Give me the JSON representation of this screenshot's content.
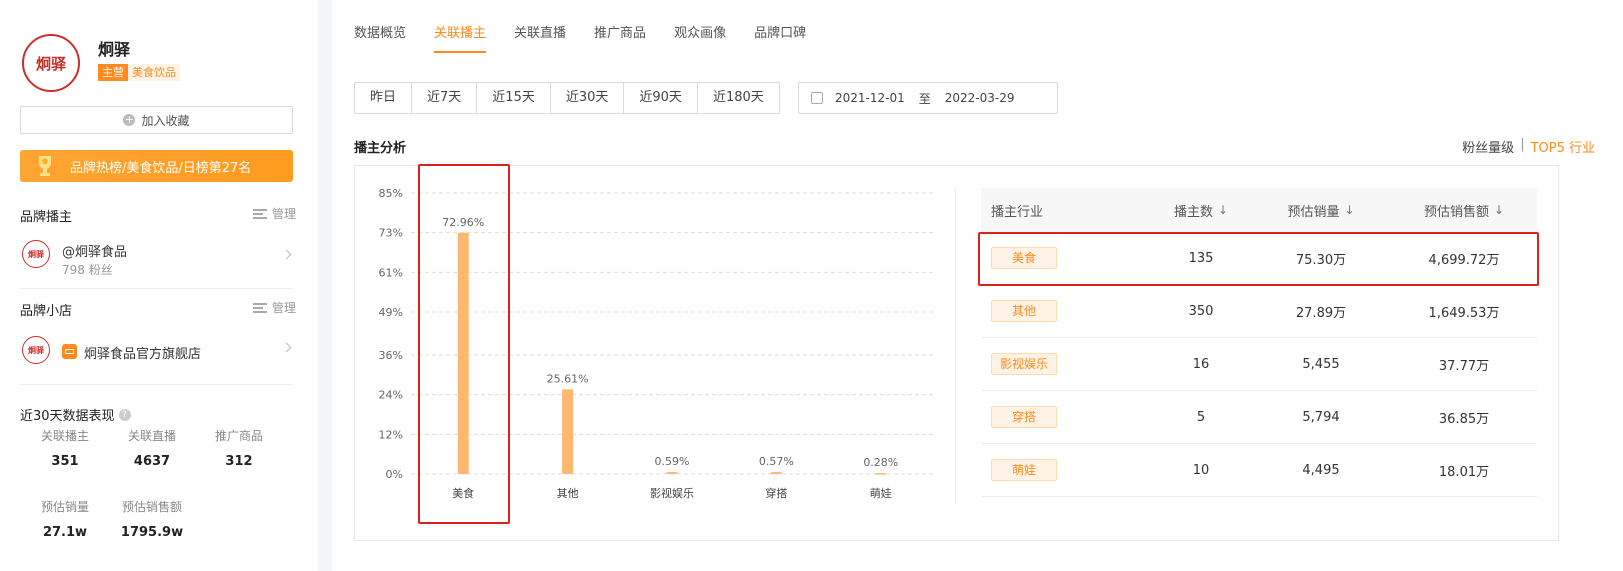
{
  "sidebar": {
    "brand_name": "炯驿",
    "logo_text": "炯驿",
    "tag_main": "主营",
    "tag_category": "美食饮品",
    "fav_button": "加入收藏",
    "rank_banner": "品牌热榜/美食饮品/日榜第27名",
    "anchor_section": "品牌播主",
    "manage_label": "管理",
    "anchor": {
      "name": "@炯驿食品",
      "fans": "798 粉丝"
    },
    "shop_section": "品牌小店",
    "shop": {
      "name": "炯驿食品官方旗舰店"
    },
    "stats_title": "近30天数据表现",
    "stats": [
      {
        "label": "关联播主",
        "value": "351"
      },
      {
        "label": "关联直播",
        "value": "4637"
      },
      {
        "label": "推广商品",
        "value": "312"
      },
      {
        "label": "预估销量",
        "value": "27.1w"
      },
      {
        "label": "预估销售额",
        "value": "1795.9w"
      }
    ]
  },
  "main": {
    "tabs": [
      "数据概览",
      "关联播主",
      "关联直播",
      "推广商品",
      "观众画像",
      "品牌口碑"
    ],
    "active_tab": 1,
    "ranges": [
      "昨日",
      "近7天",
      "近15天",
      "近30天",
      "近90天",
      "近180天"
    ],
    "date_start": "2021-12-01",
    "date_sep": "至",
    "date_end": "2022-03-29",
    "analysis_title": "播主分析",
    "link_fans": "粉丝量级",
    "link_sep": "|",
    "link_top5": "TOP5 行业",
    "table": {
      "headers": [
        "播主行业",
        "播主数",
        "预估销量",
        "预估销售额"
      ],
      "sort_arrow": "↓",
      "rows": [
        {
          "industry": "美食",
          "count": "135",
          "sales": "75.30万",
          "revenue": "4,699.72万"
        },
        {
          "industry": "其他",
          "count": "350",
          "sales": "27.89万",
          "revenue": "1,649.53万"
        },
        {
          "industry": "影视娱乐",
          "count": "16",
          "sales": "5,455",
          "revenue": "37.77万"
        },
        {
          "industry": "穿搭",
          "count": "5",
          "sales": "5,794",
          "revenue": "36.85万"
        },
        {
          "industry": "萌娃",
          "count": "10",
          "sales": "4,495",
          "revenue": "18.01万"
        }
      ]
    }
  },
  "colors": {
    "accent": "#ff8a1f",
    "bar": "#ffb870",
    "highlight": "#e0201b"
  },
  "chart_data": {
    "type": "bar",
    "categories": [
      "美食",
      "其他",
      "影视娱乐",
      "穿搭",
      "萌娃"
    ],
    "values": [
      72.96,
      25.61,
      0.59,
      0.57,
      0.28
    ],
    "value_labels": [
      "72.96%",
      "25.61%",
      "0.59%",
      "0.57%",
      "0.28%"
    ],
    "y_ticks": [
      "0%",
      "12%",
      "24%",
      "36%",
      "49%",
      "61%",
      "73%",
      "85%"
    ],
    "ylim": [
      0,
      85
    ],
    "grid": true
  }
}
